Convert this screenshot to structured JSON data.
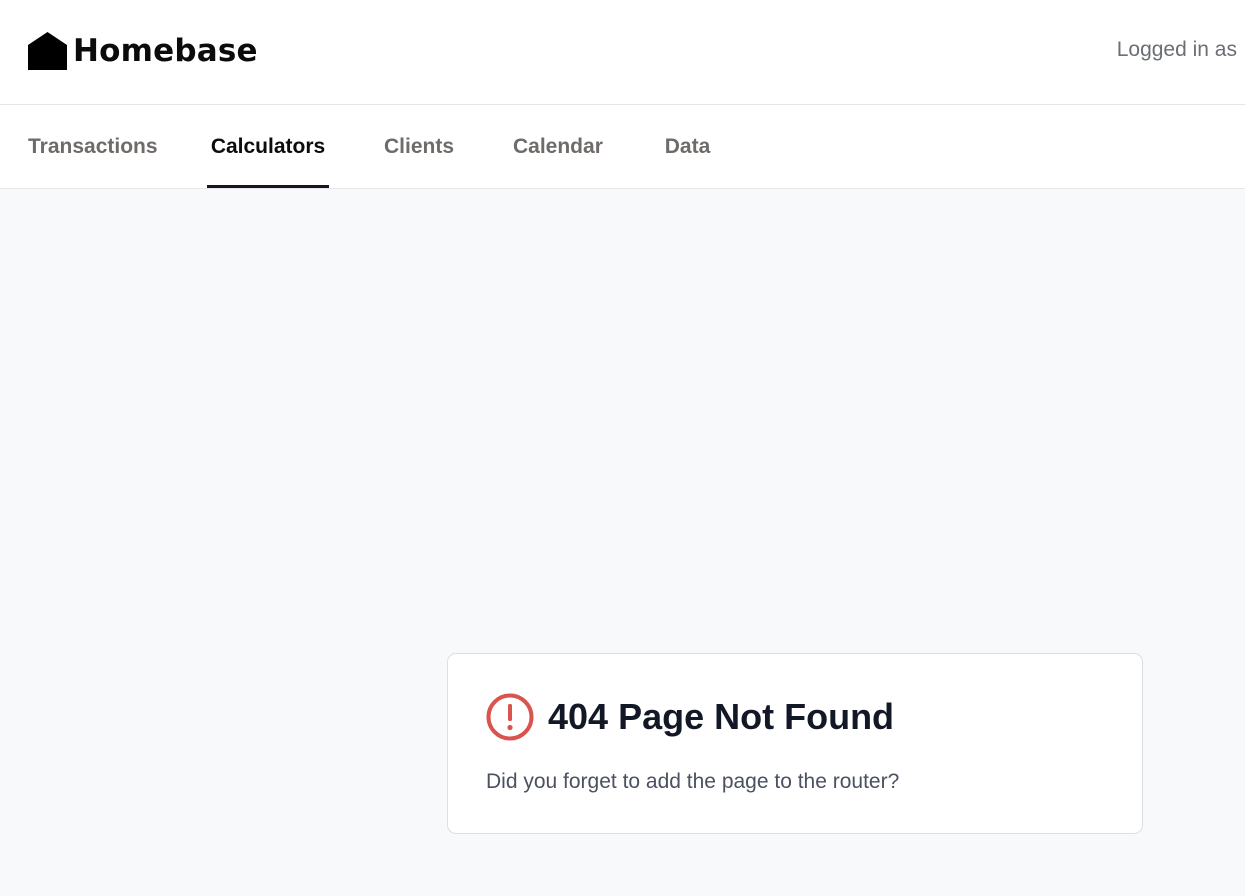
{
  "header": {
    "brand": "Homebase",
    "user_label": "Logged in as"
  },
  "nav": {
    "tabs": [
      {
        "label": "Transactions",
        "active": false
      },
      {
        "label": "Calculators",
        "active": true
      },
      {
        "label": "Clients",
        "active": false
      },
      {
        "label": "Calendar",
        "active": false
      },
      {
        "label": "Data",
        "active": false
      }
    ]
  },
  "error": {
    "title": "404 Page Not Found",
    "message": "Did you forget to add the page to the router?",
    "icon": "alert-circle-icon",
    "icon_color": "#d9534f"
  },
  "colors": {
    "background": "#f8f9fb",
    "active_tab_underline": "#161625",
    "inactive_tab_text": "#6f6b68"
  }
}
